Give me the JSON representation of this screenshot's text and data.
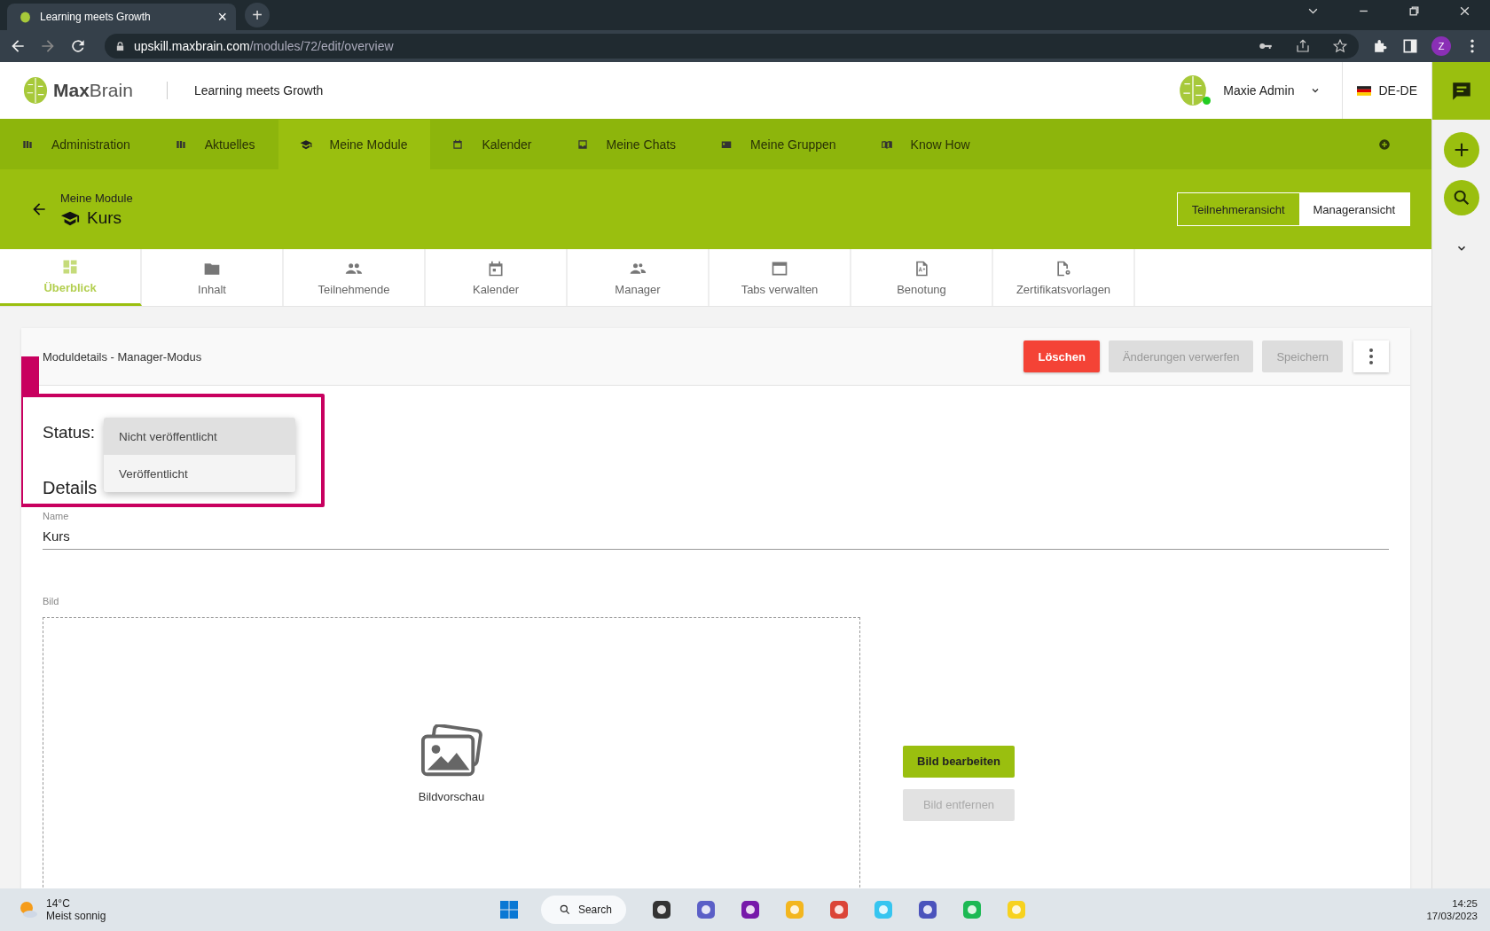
{
  "browser": {
    "tab_title": "Learning meets Growth",
    "tab_close": "×",
    "new_tab": "+",
    "url_host": "upskill.maxbrain.com",
    "url_path": "/modules/72/edit/overview",
    "profile_initial": "Z"
  },
  "header": {
    "brand_bold": "Max",
    "brand_light": "Brain",
    "tagline": "Learning meets Growth",
    "user_name": "Maxie Admin",
    "online": true,
    "locale": "DE-DE"
  },
  "nav": [
    {
      "label": "Administration",
      "selected": false
    },
    {
      "label": "Aktuelles",
      "selected": false
    },
    {
      "label": "Meine Module",
      "selected": true
    },
    {
      "label": "Kalender",
      "selected": false
    },
    {
      "label": "Meine Chats",
      "selected": false
    },
    {
      "label": "Meine Gruppen",
      "selected": false
    },
    {
      "label": "Know How",
      "selected": false
    }
  ],
  "page_header": {
    "breadcrumb": "Meine Module",
    "title": "Kurs",
    "views": [
      {
        "label": "Teilnehmeransicht",
        "selected": false
      },
      {
        "label": "Manageransicht",
        "selected": true
      }
    ]
  },
  "tabs": [
    {
      "label": "Überblick",
      "selected": true
    },
    {
      "label": "Inhalt",
      "selected": false
    },
    {
      "label": "Teilnehmende",
      "selected": false
    },
    {
      "label": "Kalender",
      "selected": false
    },
    {
      "label": "Manager",
      "selected": false
    },
    {
      "label": "Tabs verwalten",
      "selected": false
    },
    {
      "label": "Benotung",
      "selected": false
    },
    {
      "label": "Zertifikatsvorlagen",
      "selected": false
    }
  ],
  "card": {
    "title": "Moduldetails - Manager-Modus",
    "actions": [
      {
        "label": "Löschen",
        "kind": "danger"
      },
      {
        "label": "Änderungen verwerfen",
        "kind": "disabled"
      },
      {
        "label": "Speichern",
        "kind": "disabled"
      }
    ],
    "status_label": "Status:",
    "status_options": [
      {
        "label": "Nicht veröffentlicht",
        "selected": true
      },
      {
        "label": "Veröffentlicht",
        "selected": false
      }
    ],
    "details_heading": "Details",
    "name_label": "Name",
    "name_value": "Kurs",
    "image_label": "Bild",
    "image_caption": "Bildvorschau",
    "image_buttons": [
      {
        "label": "Bild bearbeiten",
        "disabled": false
      },
      {
        "label": "Bild entfernen",
        "disabled": true
      }
    ]
  },
  "taskbar": {
    "temperature": "14°C",
    "weather": "Meist sonnig",
    "search": "Search",
    "time": "14:25",
    "date": "17/03/2023"
  }
}
